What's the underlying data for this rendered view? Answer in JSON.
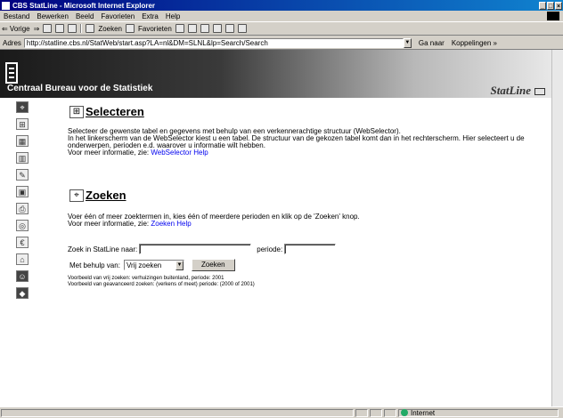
{
  "window": {
    "title": "CBS StatLine - Microsoft Internet Explorer",
    "buttons": {
      "minimize": "_",
      "maximize": "□",
      "close": "×"
    }
  },
  "menu": [
    "Bestand",
    "Bewerken",
    "Beeld",
    "Favorieten",
    "Extra",
    "Help"
  ],
  "toolbar": {
    "back": "⇐ Vorige",
    "forward": "⇒",
    "search": "Zoeken",
    "favorites": "Favorieten"
  },
  "address": {
    "label": "Adres",
    "url": "http://statline.cbs.nl/StatWeb/start.asp?LA=nl&DM=SLNL&lp=Search/Search",
    "go": "Ga naar",
    "links": "Koppelingen »"
  },
  "banner": {
    "org_name": "Centraal Bureau voor de Statistiek",
    "brand": "StatLine"
  },
  "sidebar_icons": [
    "binoculars-icon",
    "tree-icon",
    "table-icon",
    "chart-icon",
    "edit-icon",
    "save-icon",
    "print-icon",
    "network-icon",
    "currency-icon",
    "home-icon",
    "users-icon",
    "book-icon"
  ],
  "selecteren": {
    "title": "Selecteren",
    "line1": "Selecteer de gewenste tabel en gegevens met behulp van een verkennerachtige structuur (WebSelector).",
    "line2": "In het linkerscherm van de WebSelector kiest u een tabel. De structuur van de gekozen tabel komt dan in het rechterscherm. Hier selecteert u de",
    "line3": "onderwerpen, perioden e.d. waarover u informatie wilt hebben.",
    "more_prefix": "Voor meer informatie, zie: ",
    "help_link": "WebSelector Help"
  },
  "zoeken": {
    "title": "Zoeken",
    "line1": "Voer één of meer zoektermen in, kies één of meerdere perioden en klik op de 'Zoeken' knop.",
    "more_prefix": "Voor meer informatie, zie: ",
    "help_link": "Zoeken Help"
  },
  "search_form": {
    "query_label": "Zoek in StatLine naar:",
    "query_value": "",
    "period_label": "periode:",
    "period_value": "",
    "method_label": "Met behulp van:",
    "method_value": "Vrij zoeken",
    "submit": "Zoeken",
    "example1": "Voorbeeld van vrij zoeken: verhuizingen buitenland, periode: 2001",
    "example2": "Voorbeeld van geavanceerd zoeken: (verkens of meet) periode: (2000 of 2001)"
  },
  "status": {
    "zone": "Internet"
  }
}
